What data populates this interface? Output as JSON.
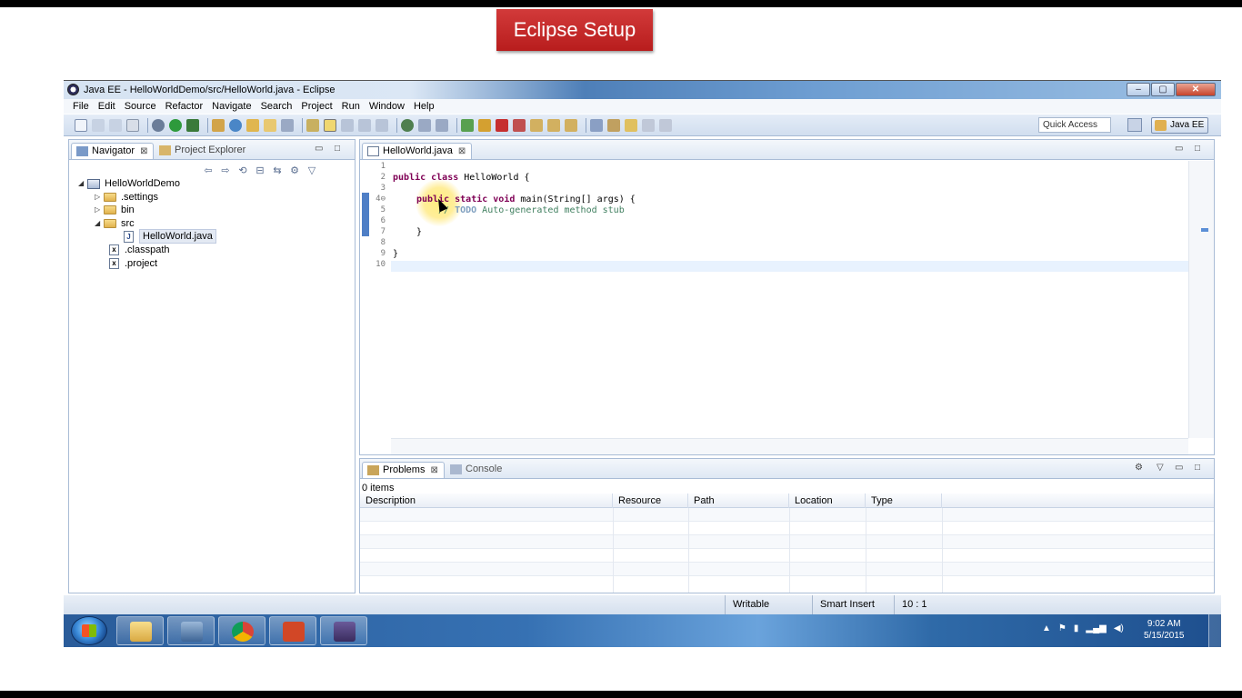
{
  "slide": {
    "title": "Eclipse Setup"
  },
  "window": {
    "title": "Java EE - HelloWorldDemo/src/HelloWorld.java - Eclipse",
    "buttons": {
      "minimize": "–",
      "maximize": "▢",
      "close": "✕"
    }
  },
  "menu": [
    "File",
    "Edit",
    "Source",
    "Refactor",
    "Navigate",
    "Search",
    "Project",
    "Run",
    "Window",
    "Help"
  ],
  "toolbar": {
    "quick_access": "Quick Access",
    "perspective": "Java EE"
  },
  "navigator": {
    "tabs": {
      "navigator": "Navigator",
      "project_explorer": "Project Explorer"
    },
    "tree": {
      "project": "HelloWorldDemo",
      "settings": ".settings",
      "bin": "bin",
      "src": "src",
      "file": "HelloWorld.java",
      "classpath": ".classpath",
      "projectfile": ".project"
    }
  },
  "editor": {
    "tab": "HelloWorld.java",
    "line_numbers": [
      "1",
      "2",
      "3",
      "4⊖",
      "5",
      "6",
      "7",
      "8",
      "9",
      "10"
    ],
    "code": {
      "l2_kw": "public class",
      "l2_rest": " HelloWorld {",
      "l4_kw": "public static void",
      "l4_rest": " main(String[] args) {",
      "l5_comment": "// ",
      "l5_todo": "TODO",
      "l5_rest": " Auto-generated method stub",
      "l7": "}",
      "l9": "}"
    }
  },
  "problems": {
    "tabs": {
      "problems": "Problems",
      "console": "Console"
    },
    "count": "0 items",
    "columns": [
      "Description",
      "Resource",
      "Path",
      "Location",
      "Type"
    ]
  },
  "status": {
    "writable": "Writable",
    "insert_mode": "Smart Insert",
    "position": "10 : 1"
  },
  "taskbar": {
    "time": "9:02 AM",
    "date": "5/15/2015",
    "apps": [
      "file-explorer",
      "toolbox",
      "chrome",
      "powerpoint",
      "eclipse-installer"
    ]
  },
  "colors": {
    "title_red": "#c62828",
    "keyword": "#7f0055",
    "comment": "#3f7f5f",
    "current_line": "#e8f2fe"
  }
}
